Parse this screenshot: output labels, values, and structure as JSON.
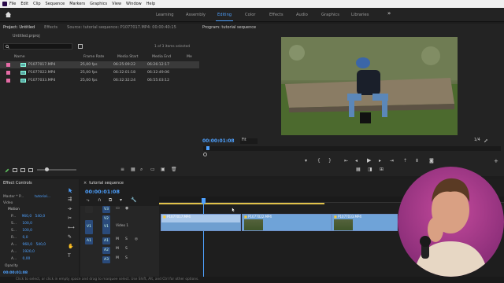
{
  "menubar": {
    "items": [
      "File",
      "Edit",
      "Clip",
      "Sequence",
      "Markers",
      "Graphics",
      "View",
      "Window",
      "Help"
    ]
  },
  "workspaces": {
    "tabs": [
      "Learning",
      "Assembly",
      "Editing",
      "Color",
      "Effects",
      "Audio",
      "Graphics",
      "Libraries"
    ],
    "active": "Editing",
    "more": "»"
  },
  "project_panel": {
    "title": "Project: Untitled",
    "tab_effects": "Effects",
    "source_label": "Source: tutorial sequence: P1077017.MP4: 00:00:40:15",
    "project_file": "Untitled.prproj",
    "selection_info": "1 of 3 items selected",
    "columns": [
      "Name",
      "Frame Rate",
      "Media Start",
      "Media End",
      "Me"
    ],
    "rows": [
      {
        "name": "P1077017.MP4",
        "frame_rate": "25,00 fps",
        "media_start": "06:25:09:22",
        "media_end": "06:26:12:17"
      },
      {
        "name": "P1077022.MP4",
        "frame_rate": "25,00 fps",
        "media_start": "06:32:01:18",
        "media_end": "06:32:49:06"
      },
      {
        "name": "P1077033.MP4",
        "frame_rate": "25,00 fps",
        "media_start": "06:32:32:24",
        "media_end": "06:55:03:12"
      }
    ]
  },
  "program_monitor": {
    "title": "Program: tutorial sequence",
    "timecode": "00:00:01:08",
    "fit": "Fit",
    "resolution": "1/4"
  },
  "effect_controls": {
    "title": "Effect Controls",
    "master_label": "Master * P...",
    "sequence_label": "tutorial...",
    "video_label": "Video",
    "motion_label": "Motion",
    "rows": [
      {
        "label": "P...",
        "value": "960,0",
        "value2": "540,0"
      },
      {
        "label": "S...",
        "value": "100,0"
      },
      {
        "label": "S...",
        "value": "100,0"
      },
      {
        "label": "R...",
        "value": "0,0"
      },
      {
        "label": "A...",
        "value": "960,0",
        "value2": "540,0"
      },
      {
        "label": "A...",
        "value": "1920,0"
      },
      {
        "label": "A...",
        "value": "0,00"
      }
    ],
    "opacity_label": "Opacity",
    "timecode": "00:00:01:08"
  },
  "timeline": {
    "title": "tutorial sequence",
    "timecode": "00:00:01:08",
    "track_names": [
      "V3",
      "V2",
      "V1",
      "A1",
      "A2",
      "A3"
    ],
    "video1_label": "Video 1",
    "clips": [
      {
        "name": "P1077017.MP4"
      },
      {
        "name": "P1077022.MP4"
      },
      {
        "name": "P1077033.MP4"
      }
    ]
  },
  "status_bar": {
    "text": "Click to select, or click in empty space and drag to marquee select. Use Shift, Alt, and Ctrl for other options."
  },
  "colors": {
    "accent": "#4ea1ff",
    "label_pink": "#e46ba6",
    "clip_video": "#6fa3d8",
    "clip_audio": "#4682c4",
    "webcam_bg": "#b5418f"
  }
}
